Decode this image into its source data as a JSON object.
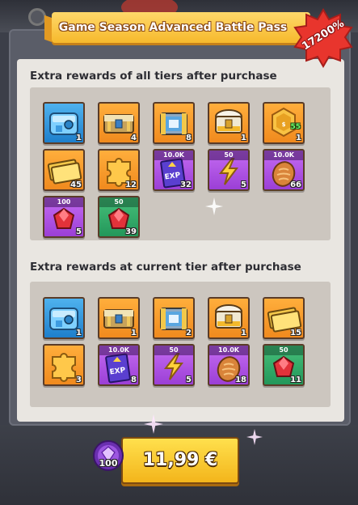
{
  "header": {
    "title": "Game Season Advanced Battle Pass",
    "bonus_badge": "17200%"
  },
  "sections": [
    {
      "title": "Extra rewards of all tiers after purchase",
      "rewards": [
        {
          "item": "blue-chest-icon",
          "tile": "blue",
          "top_label": "",
          "count": "1"
        },
        {
          "item": "gold-chest-icon",
          "tile": "orange",
          "top_label": "",
          "count": "4"
        },
        {
          "item": "blue-crate-icon",
          "tile": "orange",
          "top_label": "",
          "count": "8"
        },
        {
          "item": "treasure-chest-icon",
          "tile": "orange",
          "top_label": "",
          "count": "1"
        },
        {
          "item": "coin-badge-icon",
          "tile": "orange",
          "top_label": "",
          "count": "1",
          "sub_label": "55"
        },
        {
          "item": "gold-ticket-icon",
          "tile": "orange",
          "top_label": "",
          "count": "45"
        },
        {
          "item": "puzzle-piece-icon",
          "tile": "orange",
          "top_label": "",
          "count": "12"
        },
        {
          "item": "exp-book-icon",
          "tile": "purple",
          "top_label": "10.0K",
          "count": "32"
        },
        {
          "item": "lightning-icon",
          "tile": "purple",
          "top_label": "50",
          "count": "5"
        },
        {
          "item": "bread-icon",
          "tile": "purple",
          "top_label": "10.0K",
          "count": "66"
        },
        {
          "item": "ruby-gem-icon",
          "tile": "purple",
          "top_label": "100",
          "count": "5"
        },
        {
          "item": "ruby-gem-icon",
          "tile": "green",
          "top_label": "50",
          "count": "39"
        }
      ]
    },
    {
      "title": "Extra rewards at current tier after purchase",
      "rewards": [
        {
          "item": "blue-chest-icon",
          "tile": "blue",
          "top_label": "",
          "count": "1"
        },
        {
          "item": "gold-chest-icon",
          "tile": "orange",
          "top_label": "",
          "count": "1"
        },
        {
          "item": "blue-crate-icon",
          "tile": "orange",
          "top_label": "",
          "count": "2"
        },
        {
          "item": "treasure-chest-icon",
          "tile": "orange",
          "top_label": "",
          "count": "1"
        },
        {
          "item": "gold-ticket-icon",
          "tile": "orange",
          "top_label": "",
          "count": "15"
        },
        {
          "item": "puzzle-piece-icon",
          "tile": "orange",
          "top_label": "",
          "count": "3"
        },
        {
          "item": "exp-book-icon",
          "tile": "purple",
          "top_label": "10.0K",
          "count": "8"
        },
        {
          "item": "lightning-icon",
          "tile": "purple",
          "top_label": "50",
          "count": "5"
        },
        {
          "item": "bread-icon",
          "tile": "purple",
          "top_label": "10.0K",
          "count": "18"
        },
        {
          "item": "ruby-gem-icon",
          "tile": "green",
          "top_label": "50",
          "count": "11"
        }
      ]
    }
  ],
  "purchase": {
    "price": "11,99 €",
    "gem_bonus": "100"
  },
  "colors": {
    "ribbon": "#f6b92c",
    "badge": "#e8352d",
    "buy_button": "#f3b51b",
    "tile_orange": "#f08a1e",
    "tile_purple": "#9b3fd6",
    "tile_green": "#23975a",
    "tile_blue": "#1e7fcc"
  }
}
